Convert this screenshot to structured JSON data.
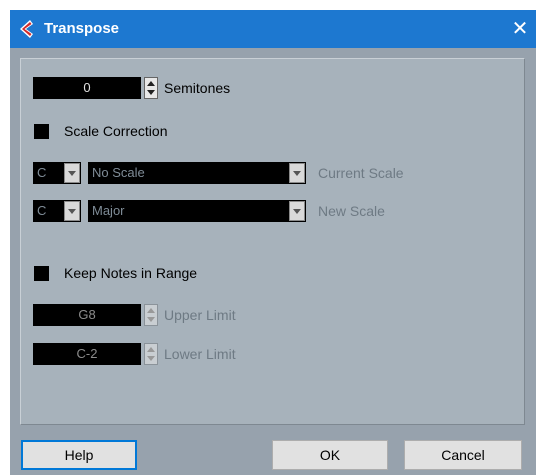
{
  "window": {
    "title": "Transpose",
    "close_glyph": "✕"
  },
  "transpose": {
    "semitones_value": "0",
    "semitones_label": "Semitones",
    "scale_correction_label": "Scale Correction",
    "current_key": "C",
    "current_scale": "No Scale",
    "current_scale_label": "Current Scale",
    "new_key": "C",
    "new_scale": "Major",
    "new_scale_label": "New Scale",
    "keep_range_label": "Keep Notes in Range",
    "upper_value": "G8",
    "upper_label": "Upper Limit",
    "lower_value": "C-2",
    "lower_label": "Lower Limit"
  },
  "buttons": {
    "help": "Help",
    "ok": "OK",
    "cancel": "Cancel"
  },
  "colors": {
    "titlebar": "#1d78d0",
    "dialog_bg": "#97a2ad",
    "panel_bg": "#a7b2bb",
    "accent_logo": "#d42a2a"
  }
}
